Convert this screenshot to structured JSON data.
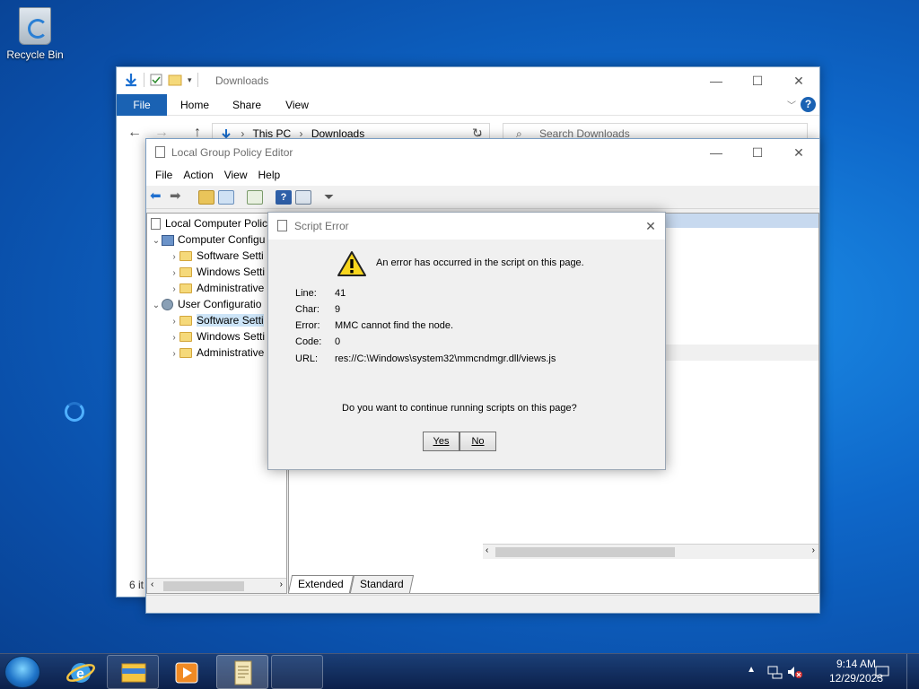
{
  "desktop": {
    "recycle_bin_label": "Recycle Bin"
  },
  "explorer": {
    "title": "Downloads",
    "ribbon_tabs": [
      "File",
      "Home",
      "Share",
      "View"
    ],
    "breadcrumb": [
      "This PC",
      "Downloads"
    ],
    "search_placeholder": "Search Downloads",
    "status": "6 it"
  },
  "gpedit": {
    "title": "Local Group Policy Editor",
    "menu": [
      "File",
      "Action",
      "View",
      "Help"
    ],
    "tree": [
      {
        "label": "Local Computer Polic",
        "level": 0
      },
      {
        "label": "Computer Configu",
        "level": 1
      },
      {
        "label": "Software Setti",
        "level": 2
      },
      {
        "label": "Windows Setti",
        "level": 2
      },
      {
        "label": "Administrative",
        "level": 2
      },
      {
        "label": "User Configuratio",
        "level": 1
      },
      {
        "label": "Software Setti",
        "level": 2
      },
      {
        "label": "Windows Setti",
        "level": 2
      },
      {
        "label": "Administrative",
        "level": 2
      }
    ],
    "tabs": [
      "Extended",
      "Standard"
    ]
  },
  "dialog": {
    "title": "Script Error",
    "message": "An error has occurred in the script on this page.",
    "fields": [
      {
        "key": "Line:",
        "value": "41"
      },
      {
        "key": "Char:",
        "value": "9"
      },
      {
        "key": "Error:",
        "value": "MMC cannot find the node."
      },
      {
        "key": "Code:",
        "value": "0"
      },
      {
        "key": "URL:",
        "value": "res://C:\\Windows\\system32\\mmcndmgr.dll/views.js"
      }
    ],
    "question": "Do you want to continue running scripts on this page?",
    "yes_label": "Yes",
    "no_label": "No"
  },
  "taskbar": {
    "time": "9:14 AM",
    "date": "12/29/2023"
  }
}
